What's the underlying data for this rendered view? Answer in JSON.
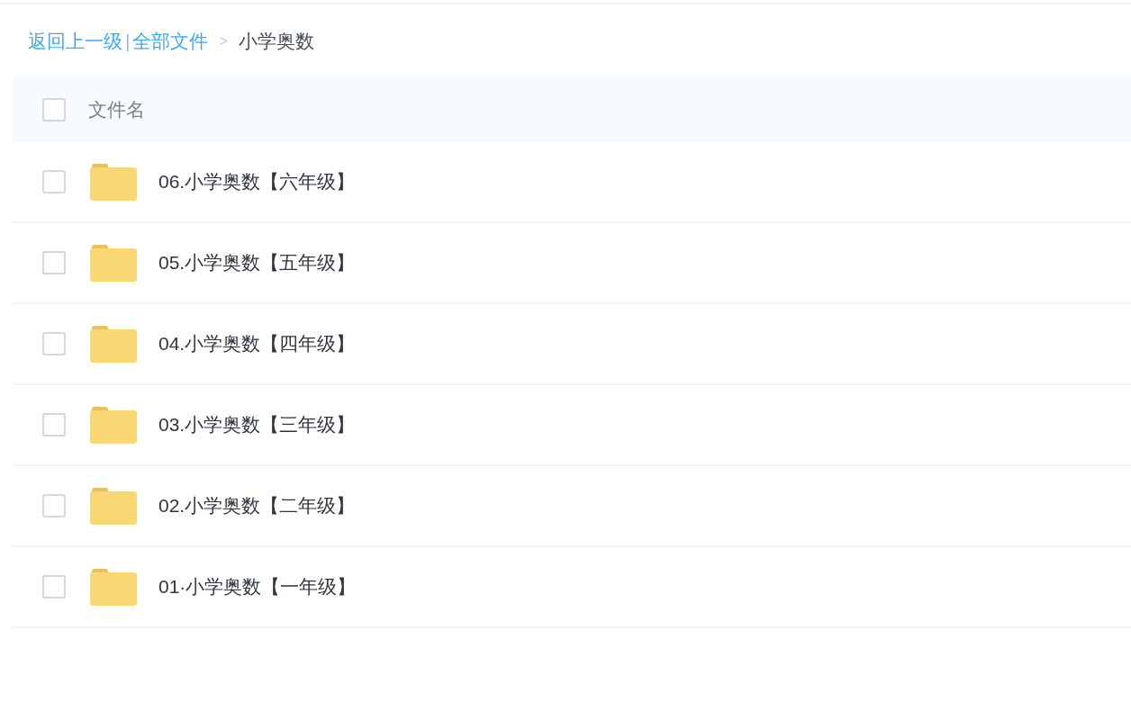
{
  "breadcrumb": [
    {
      "kind": "link",
      "text": "返回上一级"
    },
    {
      "kind": "divider",
      "text": "|"
    },
    {
      "kind": "link",
      "text": "全部文件"
    },
    {
      "kind": "arrow",
      "text": ">"
    },
    {
      "kind": "current",
      "text": "小学奥数"
    }
  ],
  "table": {
    "header": {
      "checked": false,
      "label": "文件名"
    },
    "rows": [
      {
        "checked": false,
        "name": "06.小学奥数【六年级】"
      },
      {
        "checked": false,
        "name": "05.小学奥数【五年级】"
      },
      {
        "checked": false,
        "name": "04.小学奥数【四年级】"
      },
      {
        "checked": false,
        "name": "03.小学奥数【三年级】"
      },
      {
        "checked": false,
        "name": "02.小学奥数【二年级】"
      },
      {
        "checked": false,
        "name": "01·小学奥数【一年级】"
      }
    ]
  }
}
